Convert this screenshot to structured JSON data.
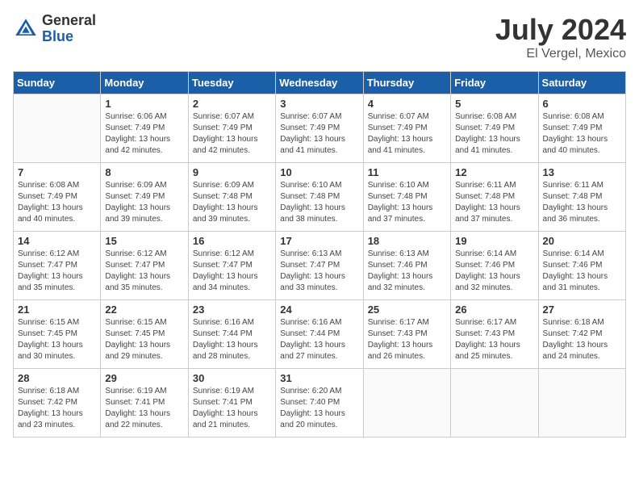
{
  "logo": {
    "general": "General",
    "blue": "Blue"
  },
  "title": "July 2024",
  "location": "El Vergel, Mexico",
  "weekdays": [
    "Sunday",
    "Monday",
    "Tuesday",
    "Wednesday",
    "Thursday",
    "Friday",
    "Saturday"
  ],
  "weeks": [
    [
      {
        "day": "",
        "sunrise": "",
        "sunset": "",
        "daylight": ""
      },
      {
        "day": "1",
        "sunrise": "Sunrise: 6:06 AM",
        "sunset": "Sunset: 7:49 PM",
        "daylight": "Daylight: 13 hours and 42 minutes."
      },
      {
        "day": "2",
        "sunrise": "Sunrise: 6:07 AM",
        "sunset": "Sunset: 7:49 PM",
        "daylight": "Daylight: 13 hours and 42 minutes."
      },
      {
        "day": "3",
        "sunrise": "Sunrise: 6:07 AM",
        "sunset": "Sunset: 7:49 PM",
        "daylight": "Daylight: 13 hours and 41 minutes."
      },
      {
        "day": "4",
        "sunrise": "Sunrise: 6:07 AM",
        "sunset": "Sunset: 7:49 PM",
        "daylight": "Daylight: 13 hours and 41 minutes."
      },
      {
        "day": "5",
        "sunrise": "Sunrise: 6:08 AM",
        "sunset": "Sunset: 7:49 PM",
        "daylight": "Daylight: 13 hours and 41 minutes."
      },
      {
        "day": "6",
        "sunrise": "Sunrise: 6:08 AM",
        "sunset": "Sunset: 7:49 PM",
        "daylight": "Daylight: 13 hours and 40 minutes."
      }
    ],
    [
      {
        "day": "7",
        "sunrise": "Sunrise: 6:08 AM",
        "sunset": "Sunset: 7:49 PM",
        "daylight": "Daylight: 13 hours and 40 minutes."
      },
      {
        "day": "8",
        "sunrise": "Sunrise: 6:09 AM",
        "sunset": "Sunset: 7:49 PM",
        "daylight": "Daylight: 13 hours and 39 minutes."
      },
      {
        "day": "9",
        "sunrise": "Sunrise: 6:09 AM",
        "sunset": "Sunset: 7:48 PM",
        "daylight": "Daylight: 13 hours and 39 minutes."
      },
      {
        "day": "10",
        "sunrise": "Sunrise: 6:10 AM",
        "sunset": "Sunset: 7:48 PM",
        "daylight": "Daylight: 13 hours and 38 minutes."
      },
      {
        "day": "11",
        "sunrise": "Sunrise: 6:10 AM",
        "sunset": "Sunset: 7:48 PM",
        "daylight": "Daylight: 13 hours and 37 minutes."
      },
      {
        "day": "12",
        "sunrise": "Sunrise: 6:11 AM",
        "sunset": "Sunset: 7:48 PM",
        "daylight": "Daylight: 13 hours and 37 minutes."
      },
      {
        "day": "13",
        "sunrise": "Sunrise: 6:11 AM",
        "sunset": "Sunset: 7:48 PM",
        "daylight": "Daylight: 13 hours and 36 minutes."
      }
    ],
    [
      {
        "day": "14",
        "sunrise": "Sunrise: 6:12 AM",
        "sunset": "Sunset: 7:47 PM",
        "daylight": "Daylight: 13 hours and 35 minutes."
      },
      {
        "day": "15",
        "sunrise": "Sunrise: 6:12 AM",
        "sunset": "Sunset: 7:47 PM",
        "daylight": "Daylight: 13 hours and 35 minutes."
      },
      {
        "day": "16",
        "sunrise": "Sunrise: 6:12 AM",
        "sunset": "Sunset: 7:47 PM",
        "daylight": "Daylight: 13 hours and 34 minutes."
      },
      {
        "day": "17",
        "sunrise": "Sunrise: 6:13 AM",
        "sunset": "Sunset: 7:47 PM",
        "daylight": "Daylight: 13 hours and 33 minutes."
      },
      {
        "day": "18",
        "sunrise": "Sunrise: 6:13 AM",
        "sunset": "Sunset: 7:46 PM",
        "daylight": "Daylight: 13 hours and 32 minutes."
      },
      {
        "day": "19",
        "sunrise": "Sunrise: 6:14 AM",
        "sunset": "Sunset: 7:46 PM",
        "daylight": "Daylight: 13 hours and 32 minutes."
      },
      {
        "day": "20",
        "sunrise": "Sunrise: 6:14 AM",
        "sunset": "Sunset: 7:46 PM",
        "daylight": "Daylight: 13 hours and 31 minutes."
      }
    ],
    [
      {
        "day": "21",
        "sunrise": "Sunrise: 6:15 AM",
        "sunset": "Sunset: 7:45 PM",
        "daylight": "Daylight: 13 hours and 30 minutes."
      },
      {
        "day": "22",
        "sunrise": "Sunrise: 6:15 AM",
        "sunset": "Sunset: 7:45 PM",
        "daylight": "Daylight: 13 hours and 29 minutes."
      },
      {
        "day": "23",
        "sunrise": "Sunrise: 6:16 AM",
        "sunset": "Sunset: 7:44 PM",
        "daylight": "Daylight: 13 hours and 28 minutes."
      },
      {
        "day": "24",
        "sunrise": "Sunrise: 6:16 AM",
        "sunset": "Sunset: 7:44 PM",
        "daylight": "Daylight: 13 hours and 27 minutes."
      },
      {
        "day": "25",
        "sunrise": "Sunrise: 6:17 AM",
        "sunset": "Sunset: 7:43 PM",
        "daylight": "Daylight: 13 hours and 26 minutes."
      },
      {
        "day": "26",
        "sunrise": "Sunrise: 6:17 AM",
        "sunset": "Sunset: 7:43 PM",
        "daylight": "Daylight: 13 hours and 25 minutes."
      },
      {
        "day": "27",
        "sunrise": "Sunrise: 6:18 AM",
        "sunset": "Sunset: 7:42 PM",
        "daylight": "Daylight: 13 hours and 24 minutes."
      }
    ],
    [
      {
        "day": "28",
        "sunrise": "Sunrise: 6:18 AM",
        "sunset": "Sunset: 7:42 PM",
        "daylight": "Daylight: 13 hours and 23 minutes."
      },
      {
        "day": "29",
        "sunrise": "Sunrise: 6:19 AM",
        "sunset": "Sunset: 7:41 PM",
        "daylight": "Daylight: 13 hours and 22 minutes."
      },
      {
        "day": "30",
        "sunrise": "Sunrise: 6:19 AM",
        "sunset": "Sunset: 7:41 PM",
        "daylight": "Daylight: 13 hours and 21 minutes."
      },
      {
        "day": "31",
        "sunrise": "Sunrise: 6:20 AM",
        "sunset": "Sunset: 7:40 PM",
        "daylight": "Daylight: 13 hours and 20 minutes."
      },
      {
        "day": "",
        "sunrise": "",
        "sunset": "",
        "daylight": ""
      },
      {
        "day": "",
        "sunrise": "",
        "sunset": "",
        "daylight": ""
      },
      {
        "day": "",
        "sunrise": "",
        "sunset": "",
        "daylight": ""
      }
    ]
  ]
}
